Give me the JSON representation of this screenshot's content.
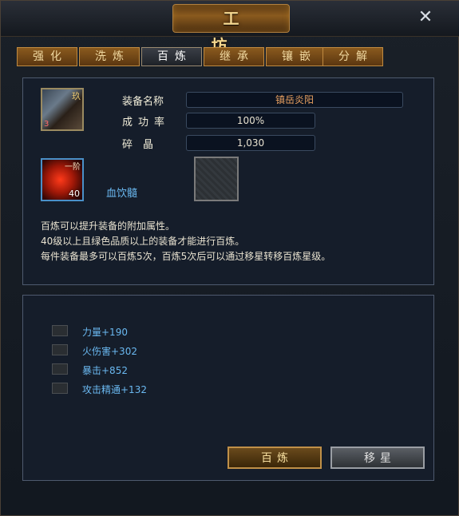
{
  "window": {
    "title": "工 坊",
    "close_icon": "close-icon"
  },
  "tabs": [
    {
      "label": "强化",
      "active": false
    },
    {
      "label": "洗炼",
      "active": false
    },
    {
      "label": "百炼",
      "active": true
    },
    {
      "label": "继承",
      "active": false
    },
    {
      "label": "镶嵌",
      "active": false
    },
    {
      "label": "分解",
      "active": false
    }
  ],
  "equipment": {
    "icon": "equipment-icon",
    "corner_label": "玖",
    "level_label": "3",
    "name_label": "装备名称",
    "name_value": "镇岳炎阳",
    "success_label": "成功率",
    "success_value": "100%",
    "shard_label": "碎　晶",
    "shard_value": "1,030"
  },
  "material": {
    "icon": "blood-gem-icon",
    "tier_label": "一阶",
    "count": "40",
    "name": "血饮髓"
  },
  "description": [
    "百炼可以提升装备的附加属性。",
    "40级以上且绿色品质以上的装备才能进行百炼。",
    "每件装备最多可以百炼5次，百炼5次后可以通过移星转移百炼星级。"
  ],
  "attributes": [
    {
      "label": "力量+190"
    },
    {
      "label": "火伤害+302"
    },
    {
      "label": "暴击+852"
    },
    {
      "label": "攻击精通+132"
    }
  ],
  "buttons": {
    "refine": "百炼",
    "move_star": "移星"
  },
  "colors": {
    "accent_gold": "#c08a40",
    "name_value": "#e8a060",
    "attribute_blue": "#6ab8f0"
  }
}
